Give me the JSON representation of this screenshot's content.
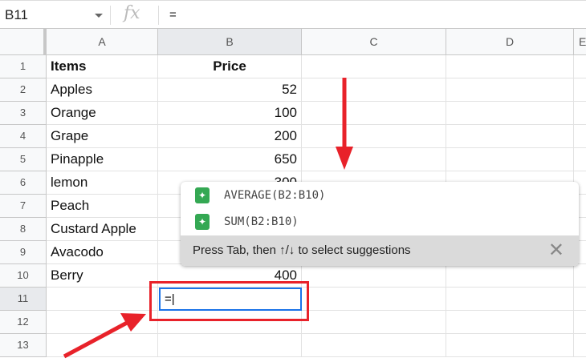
{
  "formula_bar": {
    "name_box": "B11",
    "fx": "fx",
    "value": "= "
  },
  "columns": [
    "A",
    "B",
    "C",
    "D",
    "E"
  ],
  "rows": [
    "1",
    "2",
    "3",
    "4",
    "5",
    "6",
    "7",
    "8",
    "9",
    "10",
    "11",
    "12",
    "13"
  ],
  "cells": [
    {
      "a": "Items",
      "b": "Price"
    },
    {
      "a": "Apples",
      "b": "52"
    },
    {
      "a": "Orange",
      "b": "100"
    },
    {
      "a": "Grape",
      "b": "200"
    },
    {
      "a": "Pinapple",
      "b": "650"
    },
    {
      "a": "lemon",
      "b": "300"
    },
    {
      "a": "Peach",
      "b": ""
    },
    {
      "a": "Custard Apple",
      "b": ""
    },
    {
      "a": "Avacodo",
      "b": ""
    },
    {
      "a": "Berry",
      "b": "400"
    },
    {
      "a": "",
      "b": ""
    },
    {
      "a": "",
      "b": ""
    },
    {
      "a": "",
      "b": ""
    }
  ],
  "editor_value": "=",
  "suggestions": {
    "items": [
      "AVERAGE(B2:B10)",
      "SUM(B2:B10)"
    ],
    "hint": "Press Tab, then ↑/↓ to select suggestions",
    "close": "✕"
  },
  "colors": {
    "accent": "#1a73e8",
    "annotation": "#e8222a",
    "suggest_icon": "#34a853"
  }
}
